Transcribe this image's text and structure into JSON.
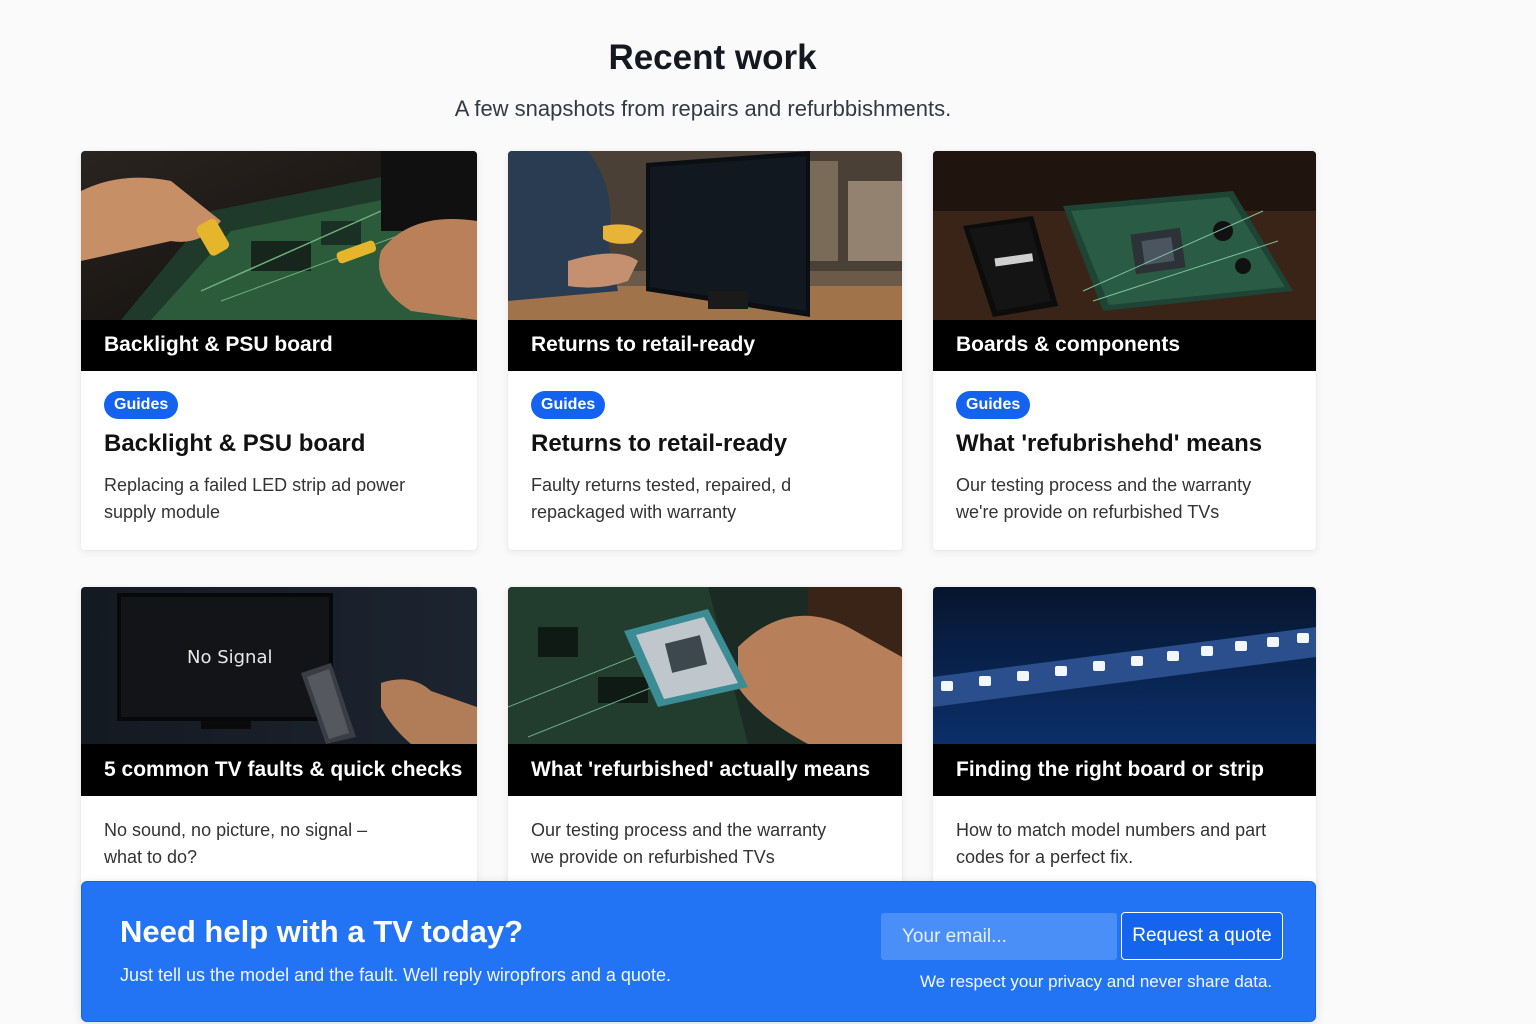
{
  "section": {
    "title": "Recent work",
    "subtitle": "A few snapshots from repairs and refurbbishments."
  },
  "cards": [
    {
      "image_icon": "soldering-board-photo-icon",
      "caption": "Backlight & PSU board",
      "badge": "Guides",
      "title": "Backlight & PSU board",
      "description": "Replacing a failed LED strip ad power supply module"
    },
    {
      "image_icon": "monitor-testing-photo-icon",
      "caption": "Returns to retail-ready",
      "badge": "Guides",
      "title": "Returns to retail-ready",
      "description": "Faulty returns tested, repaired, d repackaged with warranty"
    },
    {
      "image_icon": "circuit-boards-photo-icon",
      "caption": "Boards & components",
      "badge": "Guides",
      "title": "What 'refubrishehd' means",
      "description": "Our testing process and the warranty we're provide on refurbished TVs"
    },
    {
      "image_icon": "tv-no-signal-photo-icon",
      "image_text": "No Signal",
      "caption": "5 common TV faults & quick checks",
      "description": "No sound, no picture, no signal – what to do?"
    },
    {
      "image_icon": "chip-in-hand-photo-icon",
      "caption": "What 'refurbished' actually means",
      "description": "Our testing process and the warranty we provide on refurbished TVs"
    },
    {
      "image_icon": "led-strip-photo-icon",
      "caption": "Finding the right board or strip",
      "description": "How to match model numbers and part codes for a perfect fix."
    }
  ],
  "cta": {
    "title": "Need help with a TV today?",
    "subtitle": "Just tell us the model and the fault. Well reply wiropfrors and a quote.",
    "email_placeholder": "Your email...",
    "button_label": "Request a quote",
    "privacy": "We respect your privacy and never share data."
  }
}
